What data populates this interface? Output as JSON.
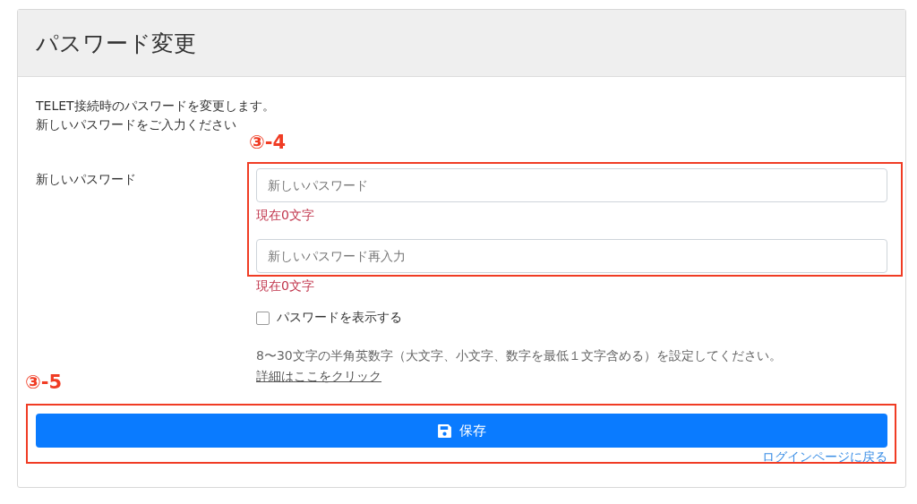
{
  "title": "パスワード変更",
  "intro": [
    "TELET接続時のパスワードを変更します。",
    "新しいパスワードをご入力ください"
  ],
  "field_label": "新しいパスワード",
  "inputs": [
    {
      "placeholder": "新しいパスワード",
      "count": "現在0文字"
    },
    {
      "placeholder": "新しいパスワード再入力",
      "count": "現在0文字"
    }
  ],
  "show_password": {
    "label": "パスワードを表示する",
    "checked": false
  },
  "hint": {
    "text": "8〜30文字の半角英数字（大文字、小文字、数字を最低１文字含める）を設定してください。",
    "link": "詳細はここをクリック"
  },
  "save_button": "保存",
  "back_link": "ログインページに戻る",
  "annotations": [
    {
      "label": "③-4"
    },
    {
      "label": "③-5"
    }
  ]
}
